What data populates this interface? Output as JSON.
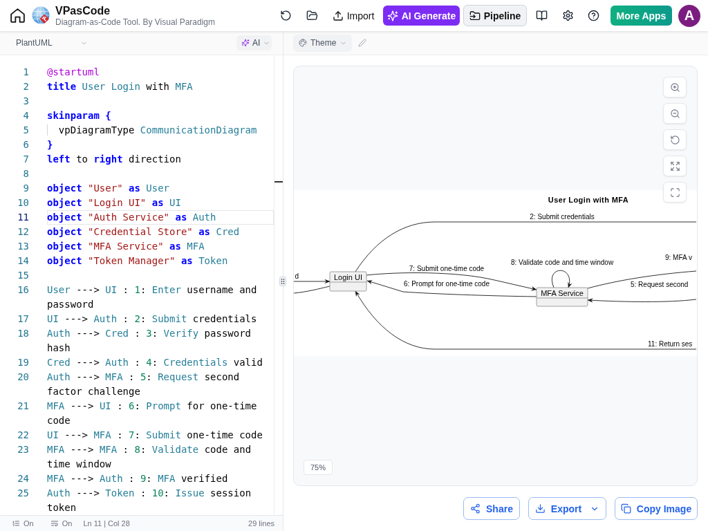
{
  "header": {
    "title": "VPasCode",
    "subtitle": "Diagram-as-Code Tool. By Visual Paradigm",
    "import_label": "Import",
    "ai_generate_label": "AI Generate",
    "pipeline_label": "Pipeline",
    "more_apps_label": "More Apps",
    "avatar_initial": "A"
  },
  "editor": {
    "language": "PlantUML",
    "ai_label": "AI",
    "lines": [
      {
        "number": "1",
        "current": false,
        "tokens": [
          {
            "kind": "directive",
            "text": "@startuml"
          }
        ]
      },
      {
        "number": "2",
        "current": false,
        "tokens": [
          {
            "kind": "keyword",
            "text": "title "
          },
          {
            "kind": "name",
            "text": "User Login"
          },
          {
            "kind": "plain",
            "text": " with "
          },
          {
            "kind": "name",
            "text": "MFA"
          }
        ]
      },
      {
        "number": "3",
        "current": false
      },
      {
        "number": "4",
        "current": false,
        "tokens": [
          {
            "kind": "keyword",
            "text": "skinparam {"
          }
        ]
      },
      {
        "number": "5",
        "current": false,
        "tokens": [
          {
            "kind": "indented",
            "text": "vpDiagramType "
          },
          {
            "kind": "name",
            "text": "CommunicationDiagram"
          }
        ]
      },
      {
        "number": "6",
        "current": false,
        "tokens": [
          {
            "kind": "keyword",
            "text": "}"
          }
        ]
      },
      {
        "number": "7",
        "current": false,
        "tokens": [
          {
            "kind": "keyword",
            "text": "left"
          },
          {
            "kind": "plain",
            "text": " to "
          },
          {
            "kind": "keyword",
            "text": "right"
          },
          {
            "kind": "plain",
            "text": " direction"
          }
        ]
      },
      {
        "number": "8",
        "current": false
      },
      {
        "number": "9",
        "current": false,
        "tokens": [
          {
            "kind": "keyword",
            "text": "object "
          },
          {
            "kind": "string",
            "text": "\"User\" "
          },
          {
            "kind": "keyword",
            "text": "as "
          },
          {
            "kind": "name",
            "text": "User"
          }
        ]
      },
      {
        "number": "10",
        "current": false,
        "tokens": [
          {
            "kind": "keyword",
            "text": "object "
          },
          {
            "kind": "string",
            "text": "\"Login UI\" "
          },
          {
            "kind": "keyword",
            "text": "as "
          },
          {
            "kind": "name",
            "text": "UI"
          }
        ]
      },
      {
        "number": "11",
        "current": true,
        "tokens": [
          {
            "kind": "keyword",
            "text": "object "
          },
          {
            "kind": "string",
            "text": "\"Auth Service\" "
          },
          {
            "kind": "keyword",
            "text": "as "
          },
          {
            "kind": "name",
            "text": "Auth"
          }
        ]
      },
      {
        "number": "12",
        "current": false,
        "tokens": [
          {
            "kind": "keyword",
            "text": "object "
          },
          {
            "kind": "string",
            "text": "\"Credential Store\" "
          },
          {
            "kind": "keyword",
            "text": "as "
          },
          {
            "kind": "name",
            "text": "Cred"
          }
        ]
      },
      {
        "number": "13",
        "current": false,
        "tokens": [
          {
            "kind": "keyword",
            "text": "object "
          },
          {
            "kind": "string",
            "text": "\"MFA Service\" "
          },
          {
            "kind": "keyword",
            "text": "as "
          },
          {
            "kind": "name",
            "text": "MFA"
          }
        ]
      },
      {
        "number": "14",
        "current": false,
        "tokens": [
          {
            "kind": "keyword",
            "text": "object "
          },
          {
            "kind": "string",
            "text": "\"Token Manager\" "
          },
          {
            "kind": "keyword",
            "text": "as "
          },
          {
            "kind": "name",
            "text": "Token"
          }
        ]
      },
      {
        "number": "15",
        "current": false
      },
      {
        "number": "16",
        "current": false,
        "tokens": [
          {
            "kind": "name",
            "text": "User"
          },
          {
            "kind": "plain",
            "text": " ---> "
          },
          {
            "kind": "name",
            "text": "UI"
          },
          {
            "kind": "plain",
            "text": " : "
          },
          {
            "kind": "number",
            "text": "1"
          },
          {
            "kind": "plain",
            "text": ": "
          },
          {
            "kind": "name",
            "text": "Enter"
          },
          {
            "kind": "plain",
            "text": " username and password"
          }
        ]
      },
      {
        "number": "17",
        "current": false,
        "tokens": [
          {
            "kind": "name",
            "text": "UI"
          },
          {
            "kind": "plain",
            "text": " ---> "
          },
          {
            "kind": "name",
            "text": "Auth"
          },
          {
            "kind": "plain",
            "text": " : "
          },
          {
            "kind": "number",
            "text": "2"
          },
          {
            "kind": "plain",
            "text": ": "
          },
          {
            "kind": "name",
            "text": "Submit"
          },
          {
            "kind": "plain",
            "text": " credentials"
          }
        ]
      },
      {
        "number": "18",
        "current": false,
        "tokens": [
          {
            "kind": "name",
            "text": "Auth"
          },
          {
            "kind": "plain",
            "text": " ---> "
          },
          {
            "kind": "name",
            "text": "Cred"
          },
          {
            "kind": "plain",
            "text": " : "
          },
          {
            "kind": "number",
            "text": "3"
          },
          {
            "kind": "plain",
            "text": ": "
          },
          {
            "kind": "name",
            "text": "Verify"
          },
          {
            "kind": "plain",
            "text": " password hash"
          }
        ]
      },
      {
        "number": "19",
        "current": false,
        "tokens": [
          {
            "kind": "name",
            "text": "Cred"
          },
          {
            "kind": "plain",
            "text": " ---> "
          },
          {
            "kind": "name",
            "text": "Auth"
          },
          {
            "kind": "plain",
            "text": " : "
          },
          {
            "kind": "number",
            "text": "4"
          },
          {
            "kind": "plain",
            "text": ": "
          },
          {
            "kind": "name",
            "text": "Credentials"
          },
          {
            "kind": "plain",
            "text": " valid"
          }
        ]
      },
      {
        "number": "20",
        "current": false,
        "tokens": [
          {
            "kind": "name",
            "text": "Auth"
          },
          {
            "kind": "plain",
            "text": " ---> "
          },
          {
            "kind": "name",
            "text": "MFA"
          },
          {
            "kind": "plain",
            "text": " : "
          },
          {
            "kind": "number",
            "text": "5"
          },
          {
            "kind": "plain",
            "text": ": "
          },
          {
            "kind": "name",
            "text": "Request"
          },
          {
            "kind": "plain",
            "text": " second factor challenge"
          }
        ]
      },
      {
        "number": "21",
        "current": false,
        "tokens": [
          {
            "kind": "name",
            "text": "MFA"
          },
          {
            "kind": "plain",
            "text": " ---> "
          },
          {
            "kind": "name",
            "text": "UI"
          },
          {
            "kind": "plain",
            "text": " : "
          },
          {
            "kind": "number",
            "text": "6"
          },
          {
            "kind": "plain",
            "text": ": "
          },
          {
            "kind": "name",
            "text": "Prompt"
          },
          {
            "kind": "plain",
            "text": " for one-time code"
          }
        ]
      },
      {
        "number": "22",
        "current": false,
        "tokens": [
          {
            "kind": "name",
            "text": "UI"
          },
          {
            "kind": "plain",
            "text": " ---> "
          },
          {
            "kind": "name",
            "text": "MFA"
          },
          {
            "kind": "plain",
            "text": " : "
          },
          {
            "kind": "number",
            "text": "7"
          },
          {
            "kind": "plain",
            "text": ": "
          },
          {
            "kind": "name",
            "text": "Submit"
          },
          {
            "kind": "plain",
            "text": " one-time code"
          }
        ]
      },
      {
        "number": "23",
        "current": false,
        "tokens": [
          {
            "kind": "name",
            "text": "MFA"
          },
          {
            "kind": "plain",
            "text": " ---> "
          },
          {
            "kind": "name",
            "text": "MFA"
          },
          {
            "kind": "plain",
            "text": " : "
          },
          {
            "kind": "number",
            "text": "8"
          },
          {
            "kind": "plain",
            "text": ": "
          },
          {
            "kind": "name",
            "text": "Validate"
          },
          {
            "kind": "plain",
            "text": " code and time window"
          }
        ]
      },
      {
        "number": "24",
        "current": false,
        "tokens": [
          {
            "kind": "name",
            "text": "MFA"
          },
          {
            "kind": "plain",
            "text": " ---> "
          },
          {
            "kind": "name",
            "text": "Auth"
          },
          {
            "kind": "plain",
            "text": " : "
          },
          {
            "kind": "number",
            "text": "9"
          },
          {
            "kind": "plain",
            "text": ": "
          },
          {
            "kind": "name",
            "text": "MFA"
          },
          {
            "kind": "plain",
            "text": " verified"
          }
        ]
      },
      {
        "number": "25",
        "current": false,
        "tokens": [
          {
            "kind": "name",
            "text": "Auth"
          },
          {
            "kind": "plain",
            "text": " ---> "
          },
          {
            "kind": "name",
            "text": "Token"
          },
          {
            "kind": "plain",
            "text": " : "
          },
          {
            "kind": "number",
            "text": "10"
          },
          {
            "kind": "plain",
            "text": ": "
          },
          {
            "kind": "name",
            "text": "Issue"
          },
          {
            "kind": "plain",
            "text": " session token"
          }
        ]
      }
    ]
  },
  "status_bar": {
    "line_numbers": "On",
    "word_wrap": "On",
    "cursor": "Ln 11 | Col 28",
    "line_count": "29 lines"
  },
  "preview": {
    "theme_label": "Theme",
    "diagram": {
      "title": "User Login with MFA",
      "nodes": [
        {
          "label": "Login UI"
        },
        {
          "label": "MFA Service"
        }
      ],
      "messages": [
        {
          "label": "d"
        },
        {
          "label": "2: Submit credentials"
        },
        {
          "label": "7: Submit one-time code"
        },
        {
          "label": "6: Prompt for one-time code"
        },
        {
          "label": "8: Validate code and time window"
        },
        {
          "label": "9: MFA v"
        },
        {
          "label": "5: Request second"
        },
        {
          "label": "11: Return ses"
        }
      ]
    },
    "zoom": "75%",
    "buttons": [
      {
        "kind": "share",
        "label": "Share"
      },
      {
        "kind": "export",
        "label": "Export"
      },
      {
        "kind": "copy",
        "label": "Copy Image"
      }
    ]
  }
}
